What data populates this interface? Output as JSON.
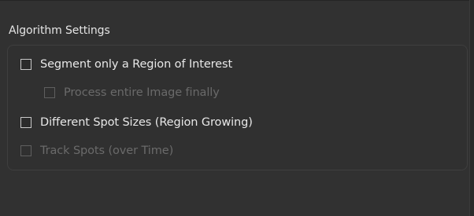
{
  "group": {
    "title": "Algorithm Settings"
  },
  "options": {
    "segment_roi": {
      "label": "Segment only a Region of Interest",
      "checked": false,
      "enabled": true
    },
    "process_entire": {
      "label": "Process entire Image finally",
      "checked": false,
      "enabled": false
    },
    "different_spot_sizes": {
      "label": "Different Spot Sizes (Region Growing)",
      "checked": false,
      "enabled": true
    },
    "track_spots": {
      "label": "Track Spots (over Time)",
      "checked": false,
      "enabled": false
    }
  }
}
